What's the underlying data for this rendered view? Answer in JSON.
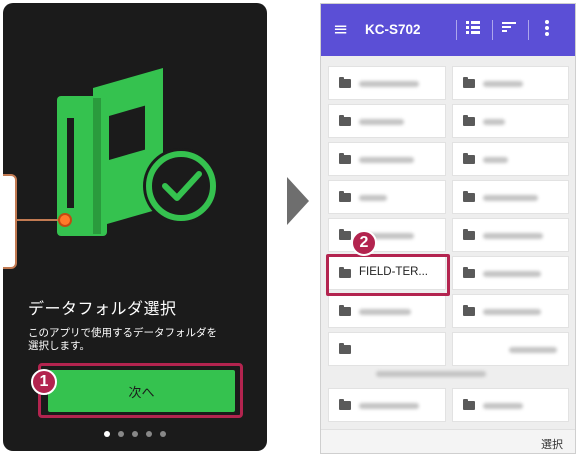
{
  "onboarding": {
    "title": "データフォルダ選択",
    "description_line1": "このアプリで使用するデータフォルダを",
    "description_line2": "選択します。",
    "next_button": "次へ",
    "page_count": 5,
    "current_page": 1,
    "step_badge": "1",
    "illustration": "folder-books-checkmark-icon",
    "accent_color": "#35c24f"
  },
  "folder_picker": {
    "toolbar": {
      "title": "KC-S702",
      "color": "#5b4fd6",
      "icons": [
        "menu-icon",
        "list-view-icon",
        "sort-icon",
        "more-vert-icon"
      ]
    },
    "step_badge": "2",
    "selected_folder": "FIELD-TER...",
    "select_button": "選択",
    "highlight_color": "#b3244f"
  },
  "transition_arrow": "arrow-right-icon"
}
